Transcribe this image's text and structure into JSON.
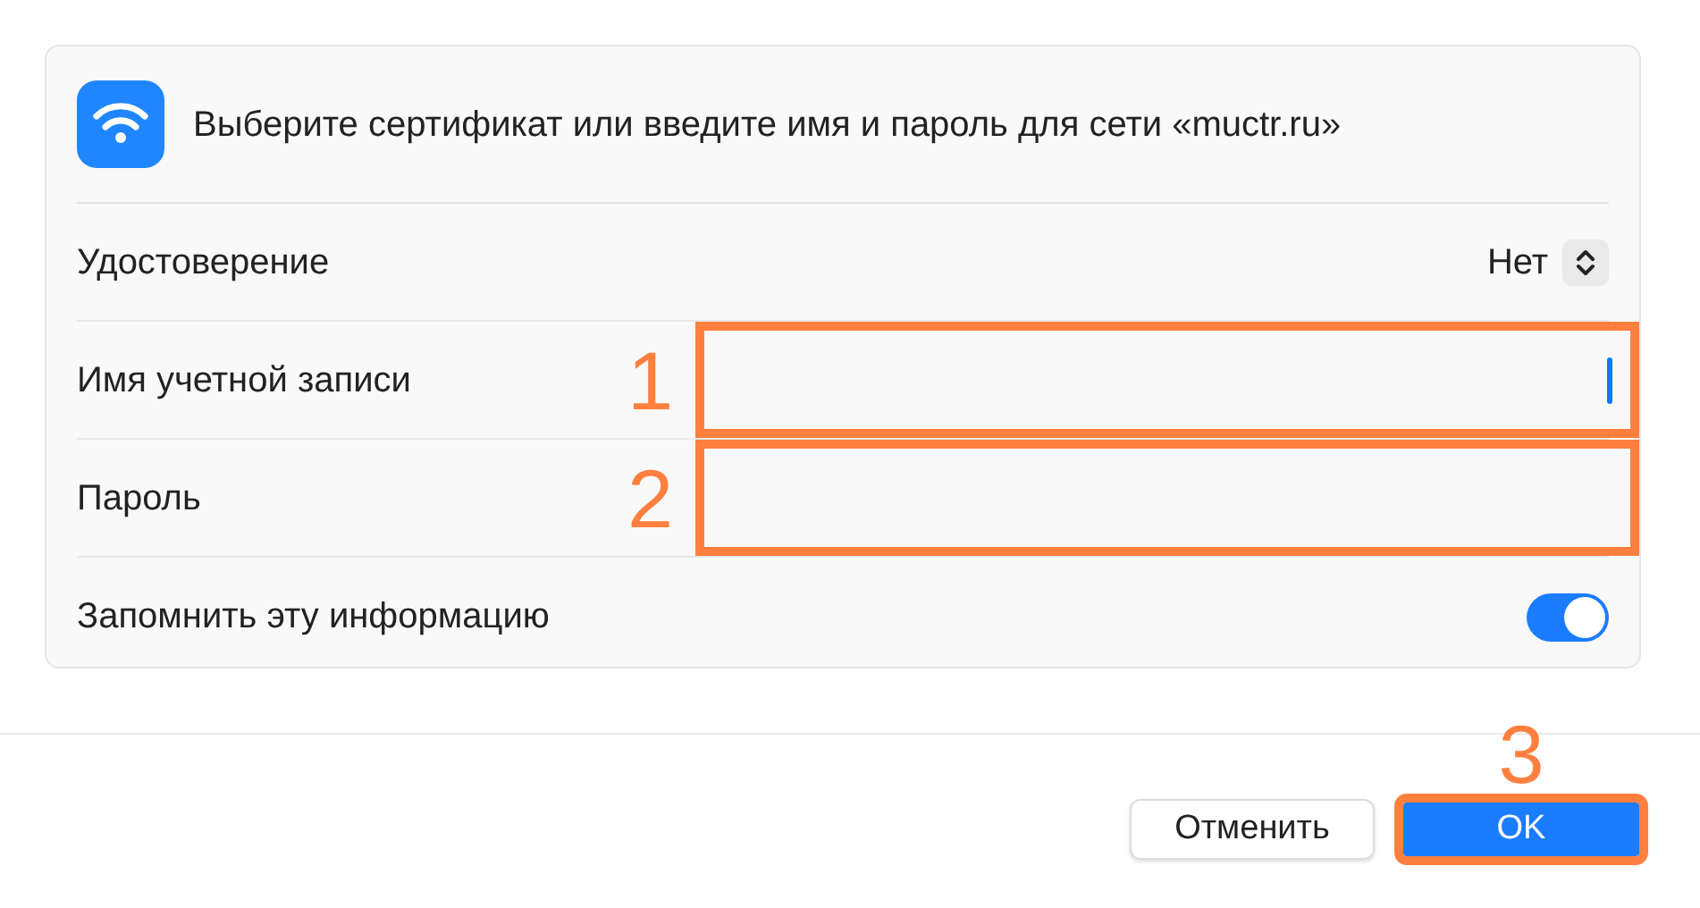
{
  "dialog": {
    "header": {
      "message": "Выберите сертификат или введите имя и пароль для сети «muctr.ru»"
    },
    "rows": [
      {
        "kind": "popup",
        "label": "Удостоверение",
        "value": "Нет"
      },
      {
        "kind": "text",
        "label": "Имя учетной записи",
        "focused": true,
        "callout": "1"
      },
      {
        "kind": "password",
        "label": "Пароль",
        "callout": "2"
      },
      {
        "kind": "toggle",
        "label": "Запомнить эту информацию",
        "on": true
      }
    ],
    "buttons": [
      {
        "label": "Отменить",
        "kind": "secondary"
      },
      {
        "label": "OK",
        "kind": "primary",
        "callout": "3"
      }
    ]
  }
}
